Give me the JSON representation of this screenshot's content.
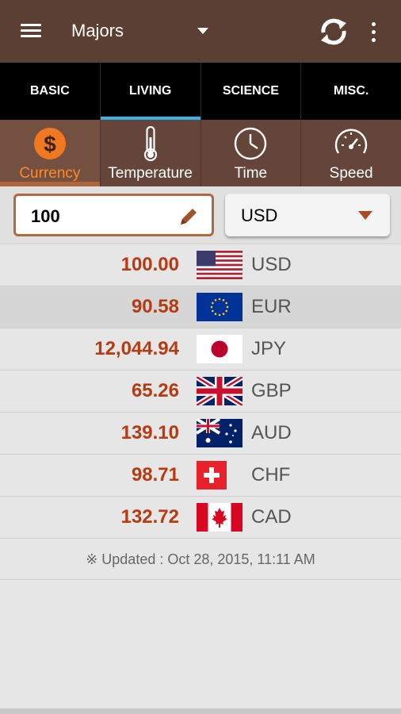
{
  "appbar": {
    "title": "Majors",
    "menu_icon": "menu-icon",
    "dropdown_icon": "caret-down-icon",
    "refresh_icon": "refresh-icon",
    "more_icon": "more-vert-icon"
  },
  "tabs": [
    {
      "label": "BASIC",
      "active": false
    },
    {
      "label": "LIVING",
      "active": true
    },
    {
      "label": "SCIENCE",
      "active": false
    },
    {
      "label": "MISC.",
      "active": false
    }
  ],
  "subtabs": [
    {
      "label": "Currency",
      "icon": "dollar-coin-icon",
      "active": true
    },
    {
      "label": "Temperature",
      "icon": "thermometer-icon",
      "active": false
    },
    {
      "label": "Time",
      "icon": "clock-icon",
      "active": false
    },
    {
      "label": "Speed",
      "icon": "speedometer-icon",
      "active": false
    }
  ],
  "converter": {
    "amount": "100",
    "edit_icon": "pencil-icon",
    "selected_currency": "USD"
  },
  "rates": [
    {
      "amount": "100.00",
      "code": "USD",
      "flag": "usa-flag-icon"
    },
    {
      "amount": "90.58",
      "code": "EUR",
      "flag": "eu-flag-icon"
    },
    {
      "amount": "12,044.94",
      "code": "JPY",
      "flag": "japan-flag-icon"
    },
    {
      "amount": "65.26",
      "code": "GBP",
      "flag": "uk-flag-icon"
    },
    {
      "amount": "139.10",
      "code": "AUD",
      "flag": "australia-flag-icon"
    },
    {
      "amount": "98.71",
      "code": "CHF",
      "flag": "switzerland-flag-icon"
    },
    {
      "amount": "132.72",
      "code": "CAD",
      "flag": "canada-flag-icon"
    }
  ],
  "updated": "※ Updated : Oct 28, 2015, 11:11 AM",
  "colors": {
    "appbar": "#5c3f33",
    "tab_indicator": "#33b5e5",
    "accent_orange": "#ff8a2a",
    "amount_red": "#b63a12"
  }
}
